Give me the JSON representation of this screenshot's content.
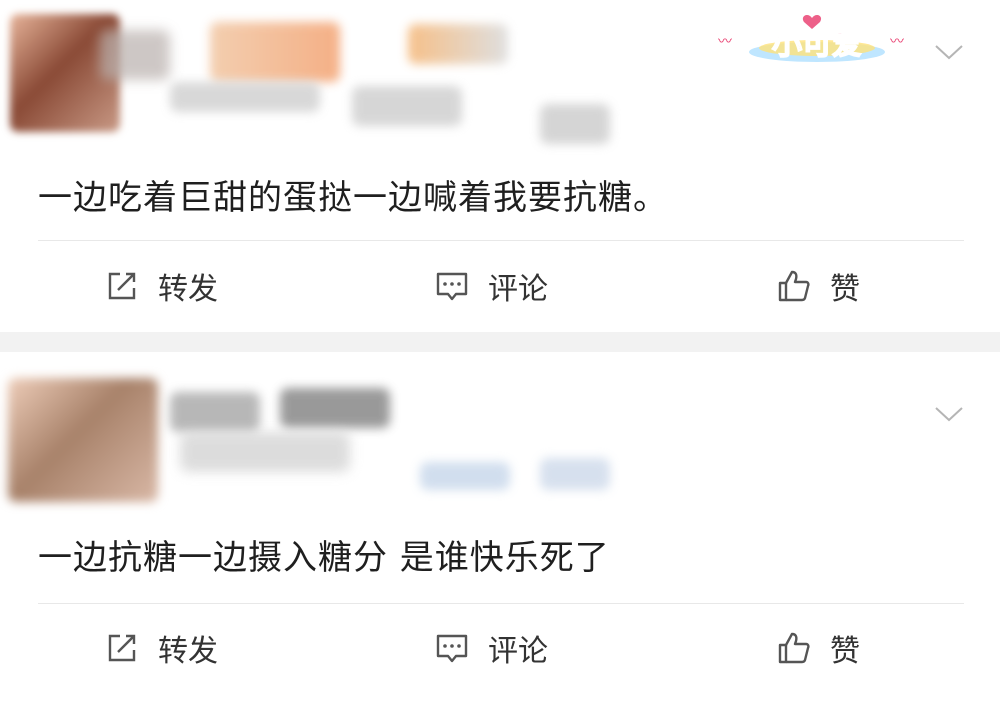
{
  "colors": {
    "background": "#f2f2f2",
    "card": "#ffffff",
    "text": "#1f1f1f",
    "action_text": "#333333",
    "icon_gray": "#555555",
    "badge_pink": "#e8386b",
    "badge_sky": "#bfe6ff",
    "badge_yellow": "#ffe27a"
  },
  "icons": {
    "collapse": "chevron-down-icon",
    "repost": "share-square-icon",
    "comment": "chat-bubble-icon",
    "like": "thumbs-up-icon"
  },
  "posts": [
    {
      "badge_text": "小可爱",
      "text": "一边吃着巨甜的蛋挞一边喊着我要抗糖。",
      "actions": {
        "repost": "转发",
        "comment": "评论",
        "like": "赞"
      }
    },
    {
      "text": "一边抗糖一边摄入糖分 是谁快乐死了",
      "actions": {
        "repost": "转发",
        "comment": "评论",
        "like": "赞"
      }
    }
  ]
}
